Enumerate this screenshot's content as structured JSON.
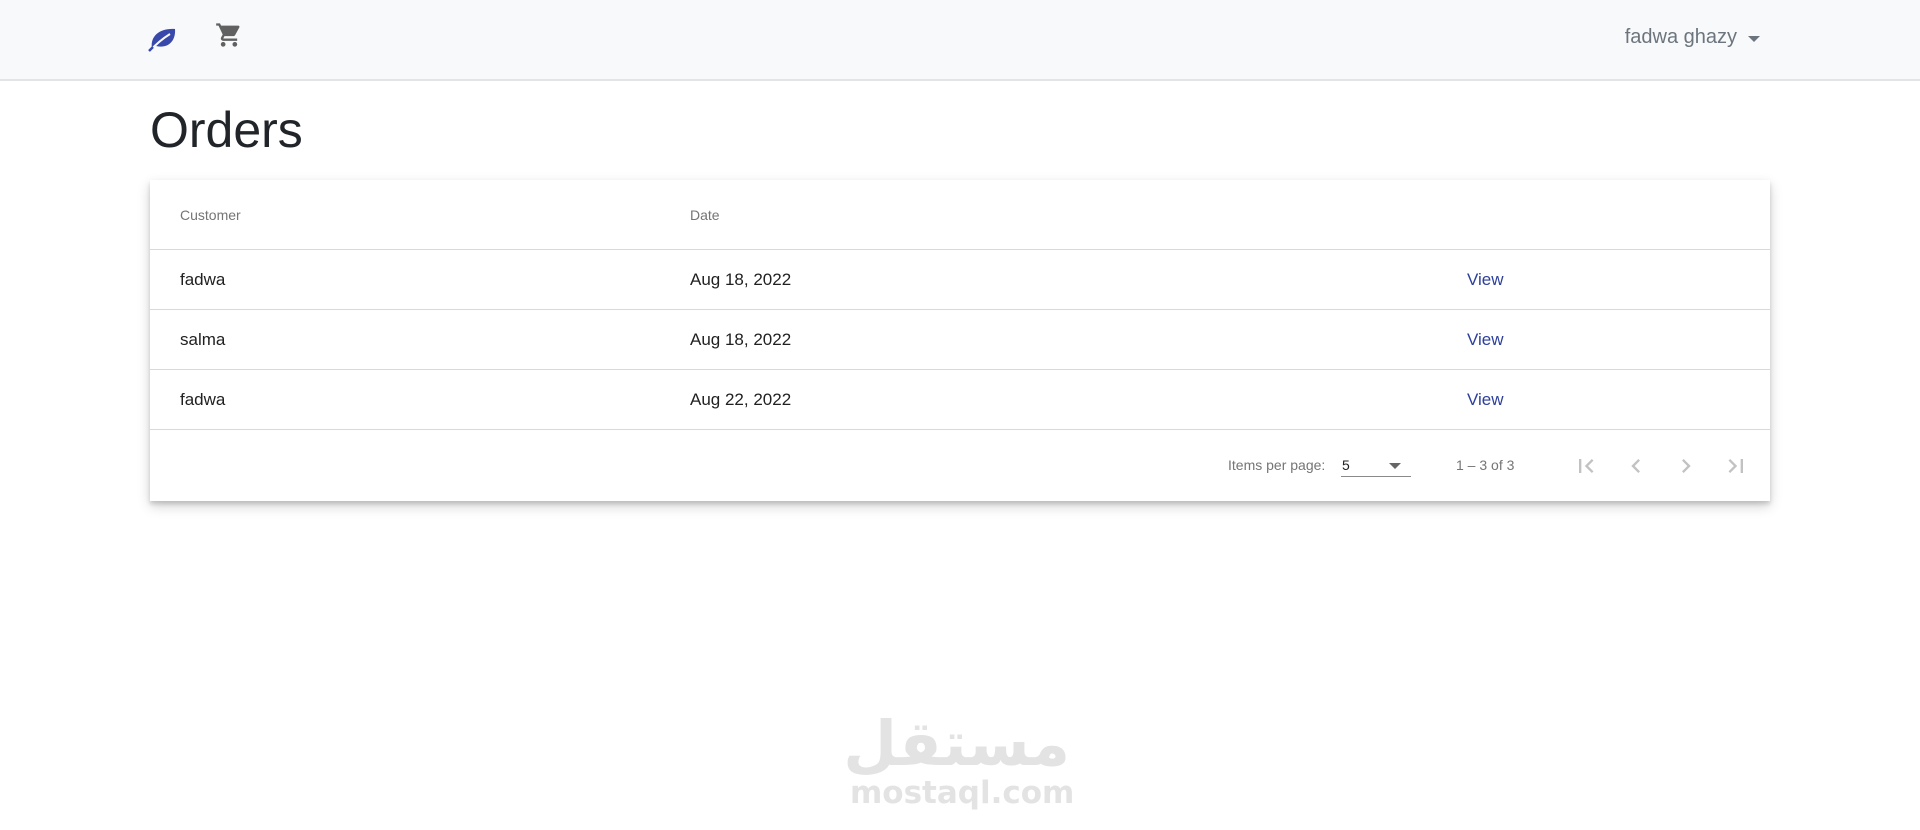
{
  "nav": {
    "brand_icon": "leaf-icon",
    "cart_icon": "shopping-cart-icon",
    "user_name": "fadwa ghazy",
    "brand_color": "#3949ab"
  },
  "page": {
    "title": "Orders"
  },
  "table": {
    "columns": [
      "Customer",
      "Date",
      ""
    ],
    "rows": [
      {
        "customer": "fadwa",
        "date": "Aug 18, 2022",
        "action": "View"
      },
      {
        "customer": "salma",
        "date": "Aug 18, 2022",
        "action": "View"
      },
      {
        "customer": "fadwa",
        "date": "Aug 22, 2022",
        "action": "View"
      }
    ],
    "link_color": "#2c3f9c"
  },
  "paginator": {
    "items_per_page_label": "Items per page:",
    "items_per_page_value": "5",
    "range_label": "1 – 3 of 3",
    "first_icon": "first-page-icon",
    "prev_icon": "chevron-left-icon",
    "next_icon": "chevron-right-icon",
    "last_icon": "last-page-icon"
  },
  "watermark": {
    "arabic": "مستقل",
    "latin": "mostaql.com"
  }
}
